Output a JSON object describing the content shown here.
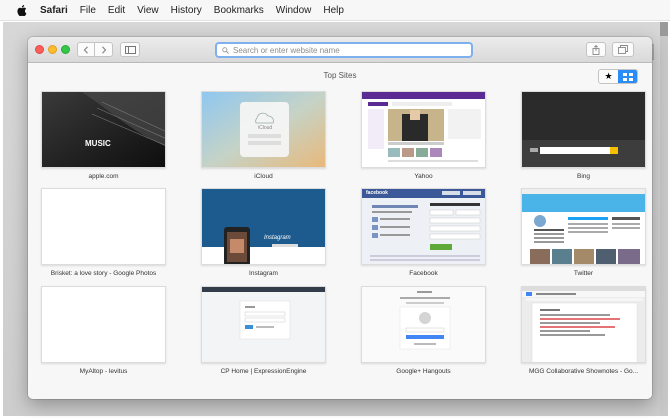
{
  "menubar": {
    "apple_icon": "apple-logo-icon",
    "items": [
      "Safari",
      "File",
      "Edit",
      "View",
      "History",
      "Bookmarks",
      "Window",
      "Help"
    ]
  },
  "toolbar": {
    "address_placeholder": "Search or enter website name",
    "icons": [
      "back-icon",
      "forward-icon",
      "sidebar-icon",
      "search-icon",
      "share-icon",
      "tabs-icon",
      "new-tab-icon"
    ]
  },
  "top_sites": {
    "title": "Top Sites",
    "toggle_star": "★",
    "tiles": [
      {
        "label": "apple.com",
        "thumb_text": "MUSIC"
      },
      {
        "label": "iCloud",
        "thumb_text": "iCloud"
      },
      {
        "label": "Yahoo"
      },
      {
        "label": "Bing"
      },
      {
        "label": "Brisket: a love story - Google Photos"
      },
      {
        "label": "Instagram",
        "thumb_text": "Instagram"
      },
      {
        "label": "Facebook",
        "thumb_text": "facebook"
      },
      {
        "label": "Twitter"
      },
      {
        "label": "MyAltop - levitus"
      },
      {
        "label": "CP Home | ExpressionEngine"
      },
      {
        "label": "Google+ Hangouts"
      },
      {
        "label": "MGG Collaborative Shownotes - Go..."
      }
    ]
  },
  "colors": {
    "accent": "#2a8cf6",
    "facebook_blue": "#3b5998",
    "instagram_blue": "#1d5b8f",
    "twitter_blue": "#1da1f2",
    "yahoo_purple": "#5b2a93"
  }
}
